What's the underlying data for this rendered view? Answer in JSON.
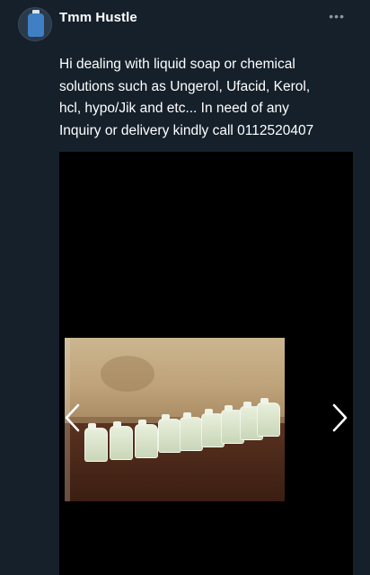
{
  "author": {
    "name": "Tmm Hustle"
  },
  "tweet": {
    "lines": [
      "Hi dealing with liquid soap or chemical",
      "solutions such as Ungerol, Ufacid, Kerol,",
      "hcl, hypo/Jik and etc... In need of any",
      "Inquiry or delivery kindly call 0112520407"
    ]
  },
  "menu": {
    "more_label": "•••"
  },
  "icons": {
    "avatar": "bottle-avatar-icon",
    "prev": "chevron-left-icon",
    "next": "chevron-right-icon",
    "more": "more-options-icon"
  },
  "colors": {
    "background": "#15202b",
    "text": "#ffffff",
    "muted": "#8899a6",
    "media_background": "#000000"
  }
}
